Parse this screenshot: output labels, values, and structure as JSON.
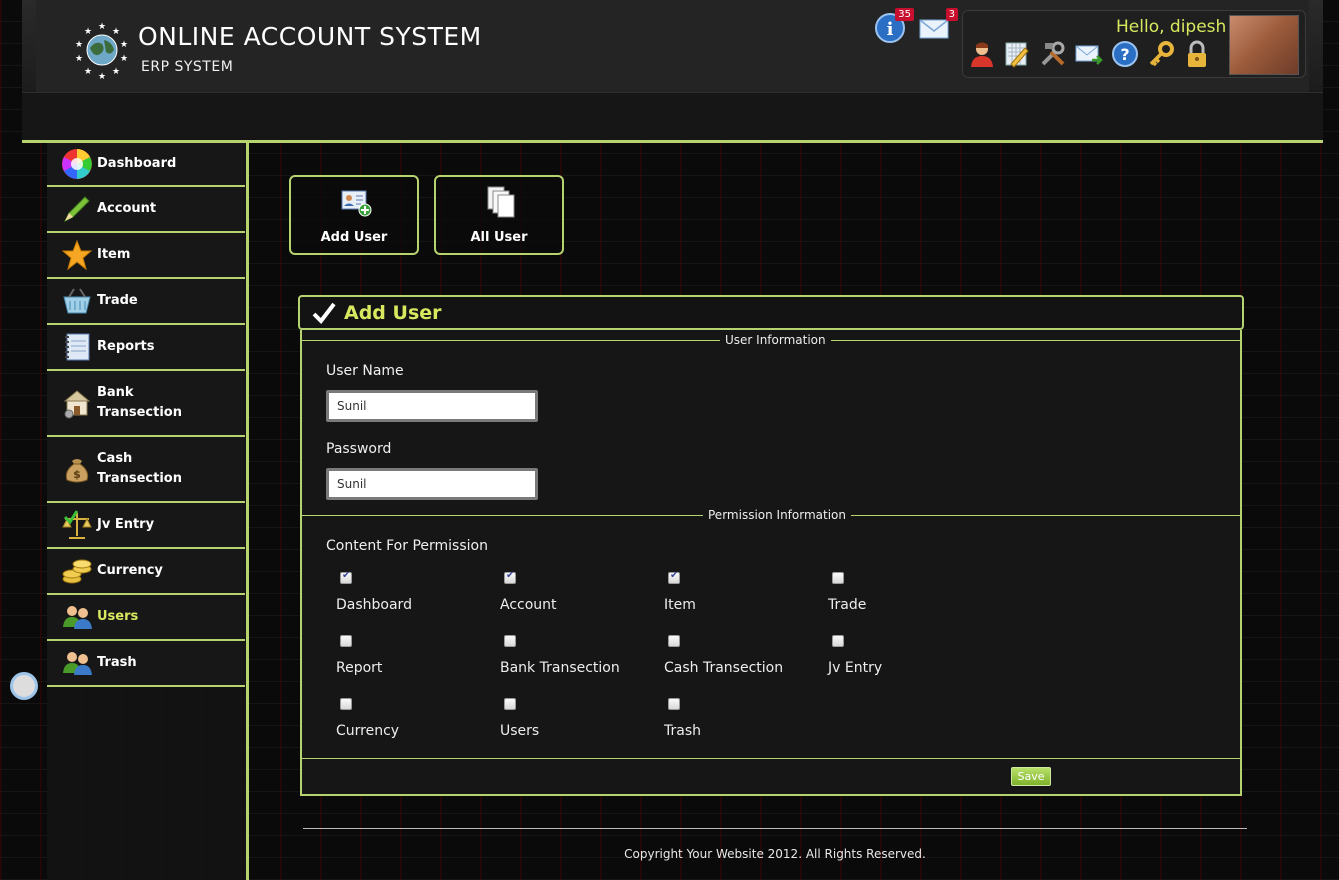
{
  "app": {
    "title": "ONLINE ACCOUNT SYSTEM",
    "subtitle": "ERP SYSTEM"
  },
  "notifications": {
    "info_count": "35",
    "mail_count": "3"
  },
  "user": {
    "greeting": "Hello, dipesh"
  },
  "header_toolbar": [
    "user-icon",
    "edit-icon",
    "tools-icon",
    "mail-forward-icon",
    "help-icon",
    "key-icon",
    "lock-icon"
  ],
  "sidebar": {
    "items": [
      {
        "label": "Dashboard",
        "icon": "color-wheel-icon"
      },
      {
        "label": "Account",
        "icon": "pen-icon"
      },
      {
        "label": "Item",
        "icon": "star-icon"
      },
      {
        "label": "Trade",
        "icon": "basket-icon"
      },
      {
        "label": "Reports",
        "icon": "notebook-icon"
      },
      {
        "label": "Bank Transection",
        "icon": "bank-icon"
      },
      {
        "label": "Cash Transection",
        "icon": "money-bag-icon"
      },
      {
        "label": "Jv Entry",
        "icon": "scale-icon"
      },
      {
        "label": "Currency",
        "icon": "coins-icon"
      },
      {
        "label": "Users",
        "icon": "users-icon",
        "active": true
      },
      {
        "label": "Trash",
        "icon": "users-icon"
      }
    ]
  },
  "quick_actions": {
    "add_user": "Add User",
    "all_user": "All User"
  },
  "panel": {
    "title": "Add User",
    "user_info_legend": "User Information",
    "user_name_label": "User Name",
    "user_name_value": "Sunil",
    "password_label": "Password",
    "password_value": "Sunil",
    "permission_legend": "Permission Information",
    "permission_heading": "Content For Permission",
    "permissions": [
      {
        "label": "Dashboard",
        "checked": true
      },
      {
        "label": "Account",
        "checked": true
      },
      {
        "label": "Item",
        "checked": true
      },
      {
        "label": "Trade",
        "checked": false
      },
      {
        "label": "Report",
        "checked": false
      },
      {
        "label": "Bank Transection",
        "checked": false
      },
      {
        "label": "Cash Transection",
        "checked": false
      },
      {
        "label": "Jv Entry",
        "checked": false
      },
      {
        "label": "Currency",
        "checked": false
      },
      {
        "label": "Users",
        "checked": false
      },
      {
        "label": "Trash",
        "checked": false
      }
    ],
    "save_label": "Save"
  },
  "footer": {
    "copyright": "Copyright Your Website 2012. All Rights Reserved."
  },
  "colors": {
    "accent": "#b6d36f",
    "highlight": "#d8e85f",
    "badge": "#c8102e"
  }
}
